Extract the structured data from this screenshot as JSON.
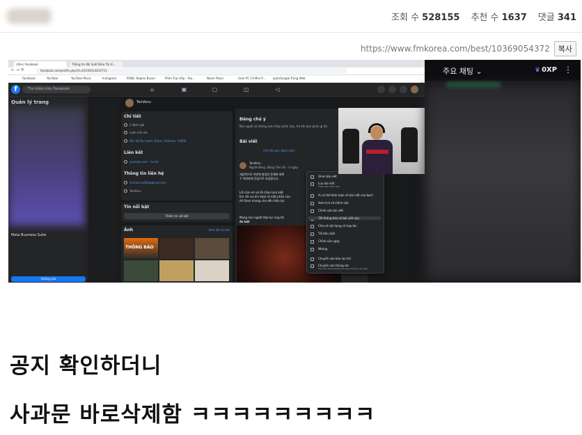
{
  "header": {
    "stats": [
      {
        "label": "조회 수",
        "value": "528155"
      },
      {
        "label": "추천 수",
        "value": "1637"
      },
      {
        "label": "댓글",
        "value": "341"
      }
    ]
  },
  "post": {
    "url": "https://www.fmkorea.com/best/10369054372",
    "copy_label": "복사",
    "lines": [
      "공지 확인하더니",
      "사과문 바로삭제함 ㅋㅋㅋㅋㅋㅋㅋㅋㅋ"
    ]
  },
  "screenshot": {
    "browser": {
      "tabs": [
        "(28+) Facebook",
        "Thông tin đội Suất Điều Tài Vi..."
      ],
      "address": "facebook.com/profile.php?id=61559314815713",
      "bookmarks": [
        "Facebook",
        "YouTube",
        "YouTube Music",
        "Instagram",
        "PUBG: Kaplan Busan",
        "Phim Trực tiếp - You...",
        "Naver Music",
        "Gear PC Cỡ Mini P...",
        "quảnGoogle Trang Web"
      ]
    },
    "facebook": {
      "search_placeholder": "Tìm kiếm trên Facebook",
      "left": {
        "title": "Quản lý trang",
        "meta_suite": "Meta Business Suite",
        "ads_button": "Quảng cáo"
      },
      "profile_name": "TenVenu",
      "details": {
        "title": "Chi tiết",
        "items": [
          "2 đánh giá",
          "Luôn mở cửa",
          "Bến đồ Bự Lượm, Hanoi, Vietnam, 10000"
        ]
      },
      "links": {
        "title": "Liên kết",
        "items": [
          "youtube.com · m.me"
        ]
      },
      "contact": {
        "title": "Thông tin liên hệ",
        "items": [
          "hoctamnu284@gmail.com",
          "TenVenu"
        ]
      },
      "featured": {
        "title": "Tin nổi bật",
        "button": "Thêm tin nổi bật"
      },
      "photos": {
        "title": "Ảnh",
        "see_all": "Xem tất cả ảnh",
        "thumb_text": "THÔNG BÁO"
      },
      "notice": {
        "title": "Đáng chú ý",
        "text": "Mọi người sẽ không xem thấy phần này, trừ khi bạn ghim gì đó."
      },
      "posts": {
        "title": "Bài viết",
        "tab": "Chế độ xem danh sách"
      },
      "post_author": "TenVenu",
      "post_meta": "Người đăng: Đăng Tiến Vũ · 4 ngày",
      "post_text": [
        "게임적으로 이번에 발생한 문제에 대해",
        "수 여러분께 진심으로 죄송합니다.",
        "Lời cảm ơn và lời chào tạm biệt",
        "Em rất vui khi được là một phần của",
        "All Stars nhưng cho đến hiện tại",
        "Mong mọi người tiếp tục ủng hộ",
        "ẩn bớt"
      ],
      "menu": [
        "Ghim bài viết",
        "Lưu bài viết",
        "Ai có thể bình luận về bài viết của bạn?",
        "Xem lịch sử chỉnh sửa",
        "Chỉnh sửa bài viết",
        "Tắt thông báo về bài viết này",
        "Chia sẻ nội dung có hợp tác",
        "Tải bản dịch",
        "Chỉnh sửa ngày",
        "Nhúng",
        "Chuyển vào kho lưu trữ",
        "Chuyển vào thùng rác"
      ],
      "menu_sub": [
        "Thêm vào danh sách",
        "Các mục trong thùng rác sẽ bị xóa sau 30 ngày."
      ]
    },
    "chat": {
      "label": "주요 채팅",
      "xp": "0XP"
    }
  }
}
